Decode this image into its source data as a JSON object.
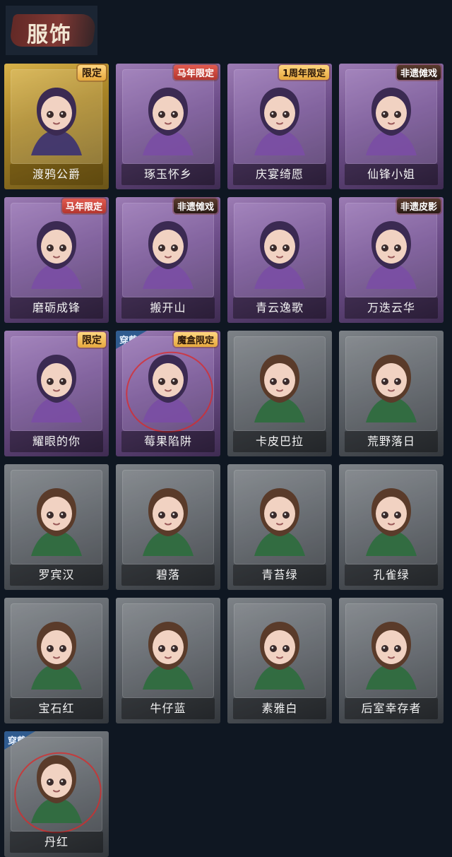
{
  "header": {
    "title": "服饰"
  },
  "items": [
    {
      "name": "渡鸦公爵",
      "badge": "限定",
      "theme": "gold",
      "worn": false
    },
    {
      "name": "琢玉怀乡",
      "badge": "马年限定",
      "theme": "purple",
      "worn": false
    },
    {
      "name": "庆宴绮愿",
      "badge": "1周年限定",
      "theme": "purple",
      "worn": false
    },
    {
      "name": "仙锋小姐",
      "badge": "非遗傩戏",
      "theme": "purple",
      "worn": false
    },
    {
      "name": "磨砺成锋",
      "badge": "马年限定",
      "theme": "purple",
      "worn": false
    },
    {
      "name": "搬开山",
      "badge": "非遗傩戏",
      "theme": "purple",
      "worn": false
    },
    {
      "name": "青云逸歌",
      "badge": "",
      "theme": "purple",
      "worn": false
    },
    {
      "name": "万迭云华",
      "badge": "非遗皮影",
      "theme": "purple",
      "worn": false
    },
    {
      "name": "耀眼的你",
      "badge": "限定",
      "theme": "purple",
      "worn": false
    },
    {
      "name": "莓果陷阱",
      "badge": "魔盒限定",
      "theme": "purple",
      "worn": true,
      "wear_label": "穿戴"
    },
    {
      "name": "卡皮巴拉",
      "badge": "",
      "theme": "grey",
      "worn": false
    },
    {
      "name": "荒野落日",
      "badge": "",
      "theme": "grey",
      "worn": false
    },
    {
      "name": "罗宾汉",
      "badge": "",
      "theme": "grey",
      "worn": false
    },
    {
      "name": "碧落",
      "badge": "",
      "theme": "grey",
      "worn": false
    },
    {
      "name": "青苔绿",
      "badge": "",
      "theme": "grey",
      "worn": false
    },
    {
      "name": "孔雀绿",
      "badge": "",
      "theme": "grey",
      "worn": false
    },
    {
      "name": "宝石红",
      "badge": "",
      "theme": "grey",
      "worn": false
    },
    {
      "name": "牛仔蓝",
      "badge": "",
      "theme": "grey",
      "worn": false
    },
    {
      "name": "素雅白",
      "badge": "",
      "theme": "grey",
      "worn": false
    },
    {
      "name": "后室幸存者",
      "badge": "",
      "theme": "grey",
      "worn": false
    },
    {
      "name": "丹红",
      "badge": "",
      "theme": "grey",
      "worn": true,
      "wear_label": "穿戴"
    }
  ],
  "icons": {
    "portrait_icon": "character-portrait-icon",
    "wear_icon": "worn-tag-icon",
    "selected_icon": "selected-ring-icon"
  }
}
